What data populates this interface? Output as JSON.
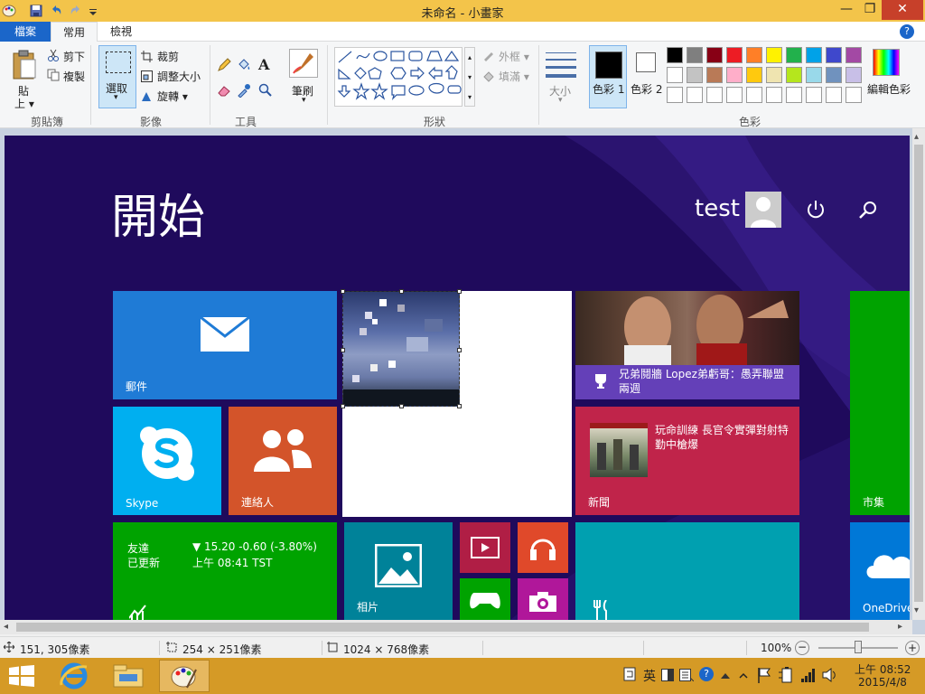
{
  "window": {
    "title": "未命名 - 小畫家",
    "min_label": "—",
    "max_label": "❐",
    "close_label": "✕"
  },
  "menu": {
    "file": "檔案",
    "home": "常用",
    "view": "檢視",
    "help": "?"
  },
  "ribbon": {
    "clipboard": {
      "paste": "貼",
      "paste_sub": "上",
      "cut": "剪下",
      "copy": "複製",
      "group": "剪貼簿"
    },
    "image": {
      "select": "選取",
      "crop": "裁剪",
      "resize": "調整大小",
      "rotate": "旋轉",
      "group": "影像"
    },
    "tools": {
      "text": "A",
      "group": "工具"
    },
    "brushes": {
      "label": "筆刷"
    },
    "shapes": {
      "outline": "外框",
      "fill": "填滿",
      "group": "形狀"
    },
    "size": {
      "label": "大小"
    },
    "colors": {
      "color1": "色彩 1",
      "color2": "色彩 2",
      "edit": "編輯色彩",
      "group": "色彩",
      "palette_row1": [
        "#000000",
        "#7f7f7f",
        "#880015",
        "#ed1c24",
        "#ff7f27",
        "#fff200",
        "#22b14c",
        "#00a2e8",
        "#3f48cc",
        "#a349a4"
      ],
      "palette_row2": [
        "#ffffff",
        "#c3c3c3",
        "#b97a57",
        "#ffaec9",
        "#ffc90e",
        "#efe4b0",
        "#b5e61d",
        "#99d9ea",
        "#7092be",
        "#c8bfe7"
      ],
      "palette_row3": [
        "#ffffff",
        "#ffffff",
        "#ffffff",
        "#ffffff",
        "#ffffff",
        "#ffffff",
        "#ffffff",
        "#ffffff",
        "#ffffff",
        "#ffffff"
      ]
    }
  },
  "start": {
    "title": "開始",
    "user": "test",
    "tiles": {
      "mail": "郵件",
      "skype": "Skype",
      "people": "連絡人",
      "news_head": "兄弟鬩牆 Lopez弟虧哥：愚弄聯盟兩週",
      "news_story": "玩命訓練 長官令實彈對射特勤中槍爆",
      "news": "新聞",
      "store": "市集",
      "finance_name": "友達",
      "finance_updated": "已更新",
      "finance_quote": "▼ 15.20  -0.60 (-3.80%)",
      "finance_time": "上午 08:41 TST",
      "photos": "相片",
      "onedrive": "OneDrive"
    }
  },
  "status": {
    "cursor": "151, 305像素",
    "selection": "254 × 251像素",
    "image_size": "1024 × 768像素",
    "zoom": "100%",
    "zoom_minus": "−",
    "zoom_plus": "+"
  },
  "taskbar": {
    "ime": "英",
    "time": "上午 08:52",
    "date": "2015/4/8"
  }
}
